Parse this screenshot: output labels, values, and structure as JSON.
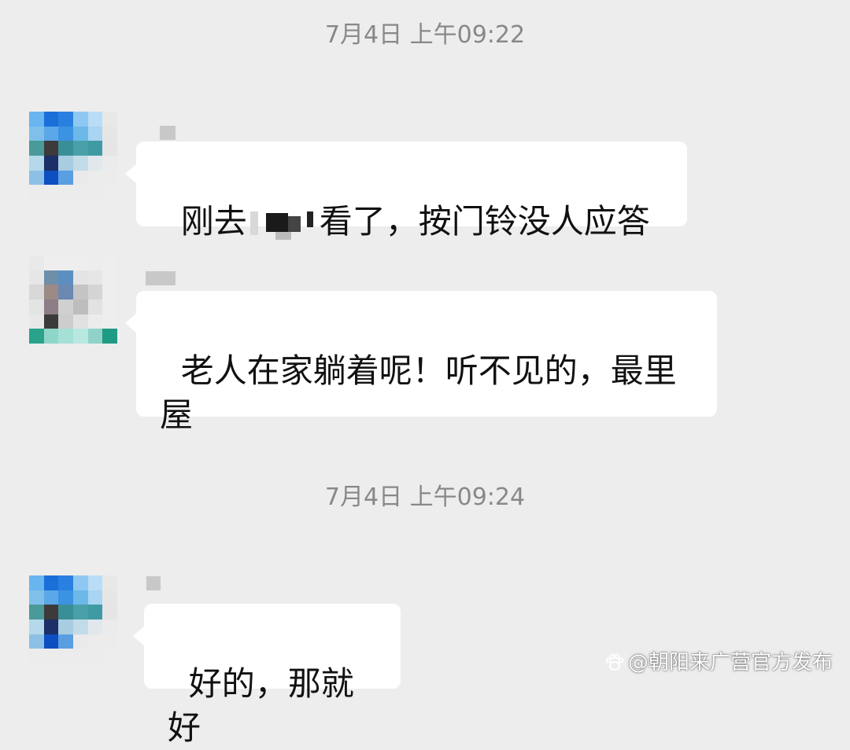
{
  "chat": {
    "timestamps": [
      "7月4日 上午09:22",
      "7月4日 上午09:24"
    ],
    "messages": [
      {
        "text_before": "刚去",
        "text_after": "看了，按门铃没人应答"
      },
      {
        "text": "老人在家躺着呢！听不见的，最里屋"
      },
      {
        "text": "好的，那就好"
      }
    ]
  },
  "watermark": {
    "text": "@朝阳来广营官方发布",
    "icon": "paw-icon"
  },
  "colors": {
    "background": "#ededed",
    "bubble": "#ffffff",
    "timestamp": "#888888",
    "text": "#111111"
  }
}
